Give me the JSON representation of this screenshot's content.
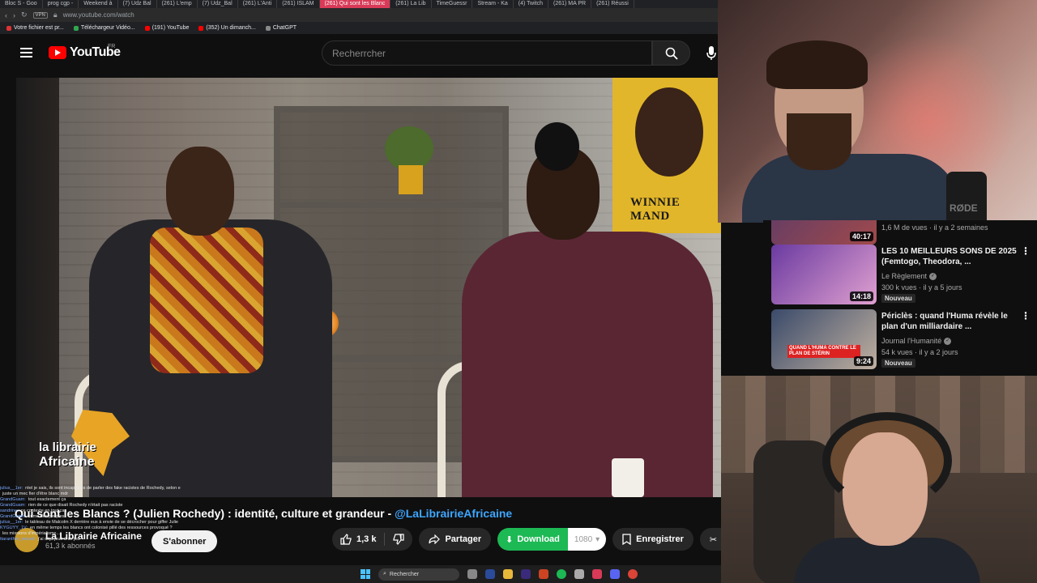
{
  "browser": {
    "tabs": [
      "Bloc S - Goo",
      "prog cgp - ",
      "Weekend à",
      "(7) Udz Bal",
      "(261) L'emp",
      "(7) Udz_Bal",
      "(261) L'Anti",
      "(261) ISLAM",
      "(261) Qui sont les Blanc",
      "(261) La Lib",
      "TimeGuessr",
      "Stream - Ka",
      "(4) Twitch",
      "(261) MA PR",
      "(261) Réussi"
    ],
    "active_tab_index": 8,
    "url": "www.youtube.com/watch",
    "vpn_label": "VPN",
    "bookmarks": [
      {
        "label": "Votre fichier est pr...",
        "color": "#d33"
      },
      {
        "label": "Téléchargeur Vidéo...",
        "color": "#2fa84f"
      },
      {
        "label": "(191) YouTube",
        "color": "#ff0000"
      },
      {
        "label": "(352) Un dimanch...",
        "color": "#ff0000"
      },
      {
        "label": "ChatGPT",
        "color": "#888"
      }
    ]
  },
  "header": {
    "logo_text": "YouTube",
    "region": "FR",
    "search_placeholder": "Recherrcher"
  },
  "video": {
    "poster_text": "WINNIE MAND",
    "logo_line1": "la librairie",
    "logo_line2": "Africaine",
    "title_main": "Qui sont les Blancs ? (Julien Rochedy) : identité, culture et grandeur - ",
    "title_handle": "@LaLibrairieAfricaine",
    "channel_name": "La Librairie Africaine",
    "subscribers": "61,3 k abonnés",
    "subscribe_label": "S'abonner",
    "likes": "1,3 k",
    "share_label": "Partager",
    "download_label": "Download",
    "download_quality": "1080",
    "save_label": "Enregistrer",
    "clip_label": "Cl"
  },
  "chat": [
    {
      "user": "julius__1er:",
      "text": "réel je sais, ils sont incapables de parler des fake racistes de Rochedy, selon e"
    },
    {
      "user": "",
      "text": "juste un mec fier d'être blanc mdr"
    },
    {
      "user": "GrandGuam:",
      "text": "tout exactement ça"
    },
    {
      "user": "GrandGuam:",
      "text": "rien de ce que disait Rochedy n'était pas raciste"
    },
    {
      "user": "sandrine:",
      "text": "ce contexte en tout cas"
    },
    {
      "user": "GrandGuam:",
      "text": "crime des peuples"
    },
    {
      "user": "julius__1er:",
      "text": "le tableau de Malcolm X derrière eux à envie de se décrocher pour giffer Julie"
    },
    {
      "user": "KYGUYY_1V:",
      "text": "en même temps les blancs ont colonisé pillé des ressources provoqué ?"
    },
    {
      "user": "",
      "text": "les missions d'impérialisme..."
    },
    {
      "user": "ttaranther_sexuel:",
      "text": "j'ai déja joué à ce jeu"
    }
  ],
  "taskbar": {
    "search_label": "Rechercher"
  },
  "webcam_top": {
    "mic_label": "RØDE"
  },
  "recommendations": [
    {
      "title": "",
      "channel": "",
      "views": "1,6 M de vues · il y a 2 semaines",
      "duration": "40:17",
      "badge": ""
    },
    {
      "title": "LES 10 MEILLEURS SONS DE 2025 (Femtogo, Theodora, ...",
      "channel": "Le Règlement",
      "views": "300 k vues · il y a 5 jours",
      "duration": "14:18",
      "badge": "Nouveau"
    },
    {
      "title": "Périclès : quand l'Huma révèle le plan d'un milliardaire ...",
      "channel": "Journal l'Humanité",
      "views": "54 k vues · il y a 2 jours",
      "duration": "9:24",
      "badge": "Nouveau",
      "thumb_caption": "QUAND L'HUMA CONTRE LE PLAN DE STÉRIN"
    }
  ],
  "colors": {
    "youtube_red": "#ff0000",
    "link_blue": "#3ea6ff",
    "download_green": "#1db954",
    "pill_bg": "#272727"
  }
}
